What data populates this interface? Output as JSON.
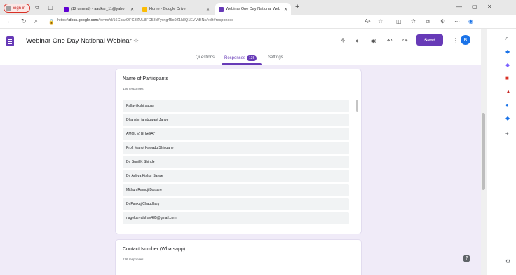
{
  "browser": {
    "profile_label": "Sign in",
    "tabs": [
      {
        "title": "(12 unread) - aadkar_11@yaho",
        "fav_color": "#6001d2"
      },
      {
        "title": "Home - Google Drive",
        "fav_color": "#fbbc04"
      },
      {
        "title": "Webinar One Day National Web",
        "fav_color": "#673ab7"
      }
    ],
    "new_tab": "+",
    "url_prefix": "https://",
    "url_host": "docs.google.com",
    "url_path": "/forms/d/16CkszOFG3ZUL8FC58d7yxng45o9Z1k8Q1EVVtBNs/edit#responses",
    "read_aloud": "Aᵃ"
  },
  "form": {
    "title": "Webinar One Day National Webinar",
    "send_label": "Send",
    "avatar_letter": "B",
    "tabs": {
      "questions": "Questions",
      "responses": "Responses",
      "responses_count": "136",
      "settings": "Settings"
    }
  },
  "cards": [
    {
      "title": "Name of Participants",
      "count": "136 responses",
      "responses": [
        "Pallavi kshirsagar",
        "Dhanshri jambuwant Janve",
        "AMOL V. BHAGAT",
        "Prof. Manoj Kawadu Shingane",
        "Dr. Sunil K Shinde",
        "Dr. Aditya Kishor Sarwe",
        "Mithun Ramuji Borsare",
        "Dr.Pankaj Chaudhary",
        "nagekarvaibhav485@gmail.com"
      ]
    },
    {
      "title": "Contact Number (Whatsapp)",
      "count": "136 responses"
    }
  ],
  "colors": {
    "accent": "#673ab7",
    "background": "#f0ebf8"
  }
}
